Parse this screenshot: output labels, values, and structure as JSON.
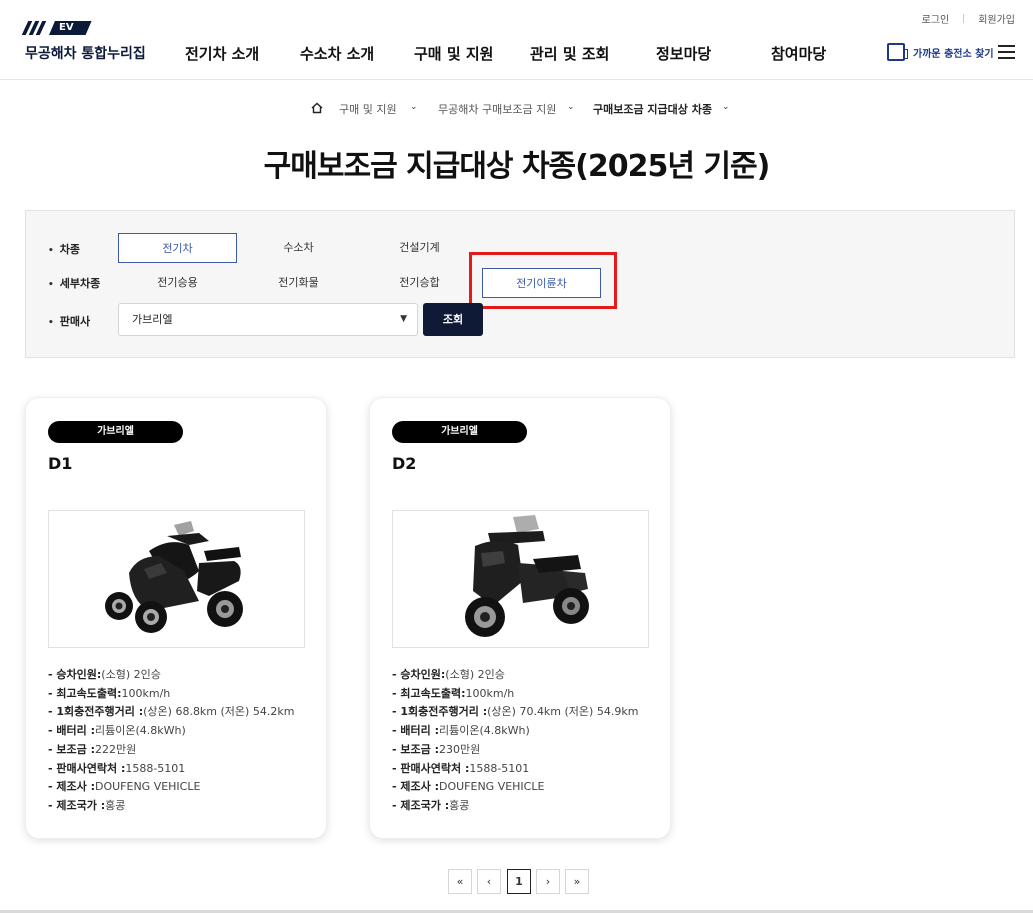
{
  "header": {
    "logo_badge": "EV",
    "logo_text": "무공해차 통합누리집",
    "login": "로그인",
    "signup": "회원가입",
    "nav": [
      "전기차 소개",
      "수소차 소개",
      "구매 및 지원",
      "관리 및 조회",
      "정보마당",
      "참여마당"
    ],
    "charger_label": "가까운 충전소 찾기"
  },
  "breadcrumb": {
    "items": [
      "구매 및 지원",
      "무공해차 구매보조금 지원",
      "구매보조금 지급대상 차종"
    ]
  },
  "page_title": "구매보조금 지급대상 차종(2025년 기준)",
  "filter": {
    "type_label": "차종",
    "types": [
      "전기차",
      "수소차",
      "건설기계"
    ],
    "selected_type": "전기차",
    "subtype_label": "세부차종",
    "subtypes": [
      "전기승용",
      "전기화물",
      "전기승합",
      "전기이륜차"
    ],
    "selected_subtype": "전기이륜차",
    "seller_label": "판매사",
    "seller_value": "가브리엘",
    "search_button": "조회"
  },
  "cards": [
    {
      "maker": "가브리엘",
      "model": "D1",
      "image": "scooter-three-wheel-black",
      "specs": [
        {
          "k": "- 승차인원:",
          "v": "(소형) 2인승"
        },
        {
          "k": "- 최고속도출력:",
          "v": "100km/h"
        },
        {
          "k": "- 1회충전주행거리 :",
          "v": "(상온) 68.8km (저온) 54.2km"
        },
        {
          "k": "- 배터리 :",
          "v": "리튬이온(4.8kWh)"
        },
        {
          "k": "- 보조금 :",
          "v": "222만원"
        },
        {
          "k": "- 판매사연락처 :",
          "v": "1588-5101"
        },
        {
          "k": "- 제조사 :",
          "v": "DOUFENG VEHICLE"
        },
        {
          "k": "- 제조국가 :",
          "v": "홍콩"
        }
      ]
    },
    {
      "maker": "가브리엘",
      "model": "D2",
      "image": "scooter-two-wheel-black",
      "specs": [
        {
          "k": "- 승차인원:",
          "v": "(소형) 2인승"
        },
        {
          "k": "- 최고속도출력:",
          "v": "100km/h"
        },
        {
          "k": "- 1회충전주행거리 :",
          "v": "(상온) 70.4km (저온) 54.9km"
        },
        {
          "k": "- 배터리 :",
          "v": "리튬이온(4.8kWh)"
        },
        {
          "k": "- 보조금 :",
          "v": "230만원"
        },
        {
          "k": "- 판매사연락처 :",
          "v": "1588-5101"
        },
        {
          "k": "- 제조사 :",
          "v": "DOUFENG VEHICLE"
        },
        {
          "k": "- 제조국가 :",
          "v": "홍콩"
        }
      ]
    }
  ],
  "pagination": {
    "first": "«",
    "prev": "‹",
    "current": "1",
    "next": "›",
    "last": "»"
  },
  "colors": {
    "brand_navy": "#0c1a3a",
    "active_blue": "#3b5ba5",
    "highlight_red": "#e21b1b"
  }
}
